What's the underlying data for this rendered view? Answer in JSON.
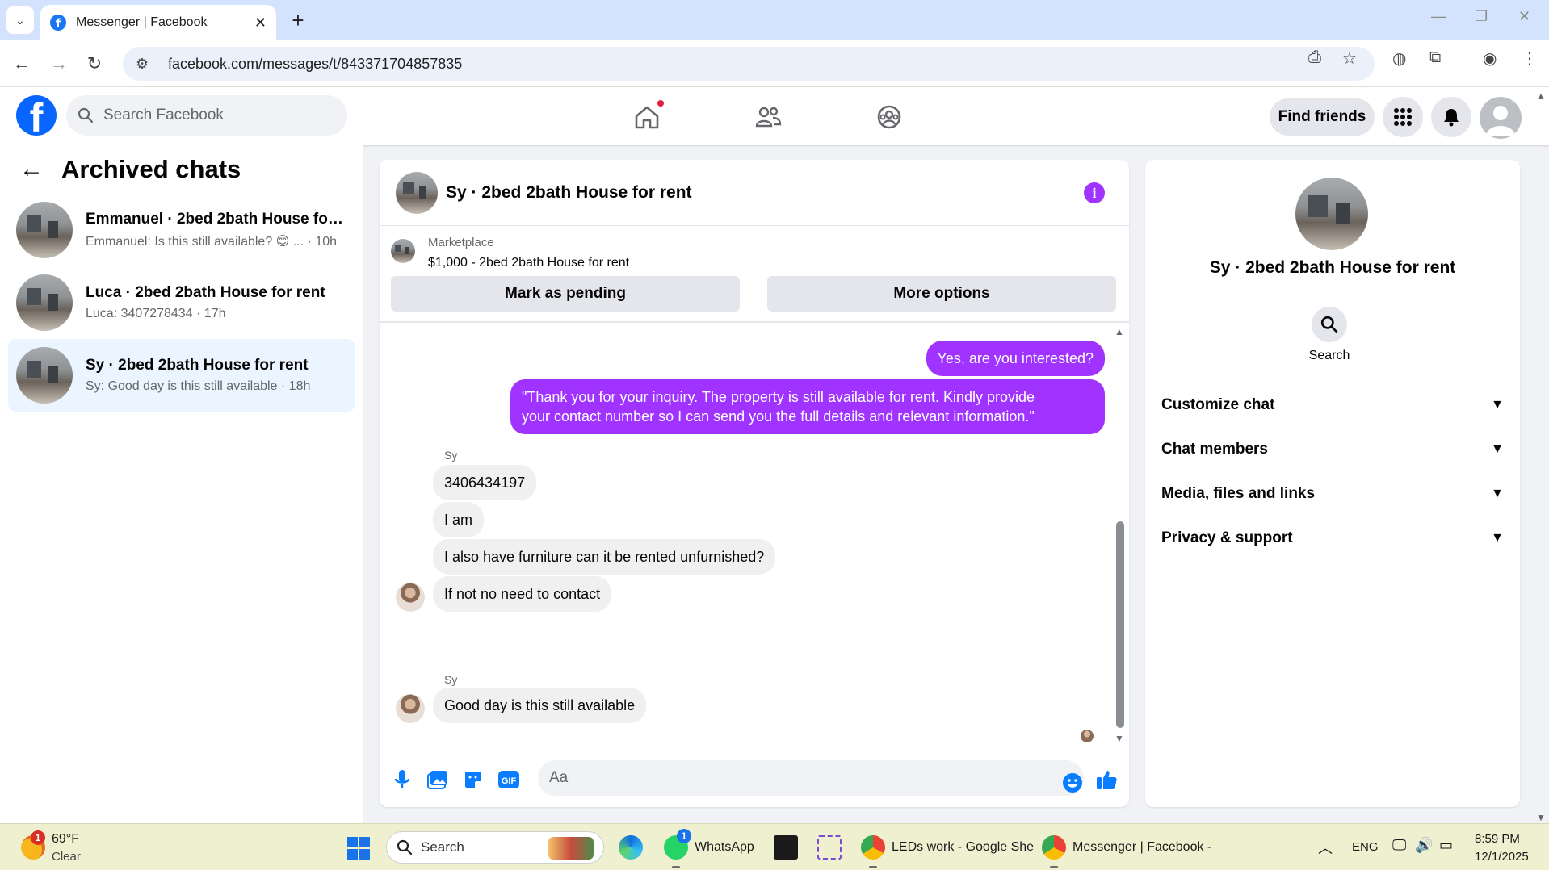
{
  "browser": {
    "tab_title": "Messenger | Facebook",
    "url": "facebook.com/messages/t/843371704857835"
  },
  "fb": {
    "search_placeholder": "Search Facebook",
    "find_friends": "Find friends"
  },
  "sidebar": {
    "title": "Archived chats",
    "chats": [
      {
        "name": "Emmanuel · 2bed 2bath House for rent",
        "preview": "Emmanuel: Is this still available? 😊 ... · 10h"
      },
      {
        "name": "Luca · 2bed 2bath House for rent",
        "preview": "Luca: 3407278434 · 17h"
      },
      {
        "name": "Sy · 2bed 2bath House for rent",
        "preview": "Sy: Good day is this still available · 18h"
      }
    ]
  },
  "conversation": {
    "title": "Sy · 2bed 2bath House for rent",
    "marketplace_label": "Marketplace",
    "listing": "$1,000 - 2bed 2bath House for rent",
    "mark_pending": "Mark as pending",
    "more_options": "More options",
    "messages": {
      "out1": "Yes, are you interested?",
      "out2_line1": "\"Thank you for your inquiry. The property is still available for rent. Kindly provide",
      "out2_line2": "your contact number so I can send you the full details and relevant information.\"",
      "sender1": "Sy",
      "in1": "3406434197",
      "in2": "I am",
      "in3": "I also have furniture can it be rented unfurnished?",
      "in4": "If not no need to contact",
      "sender2": "Sy",
      "in5": "Good day is this still available"
    },
    "composer_placeholder": "Aa"
  },
  "info_panel": {
    "name": "Sy · 2bed 2bath House for rent",
    "search_label": "Search",
    "sections": [
      "Customize chat",
      "Chat members",
      "Media, files and links",
      "Privacy & support"
    ]
  },
  "taskbar": {
    "weather_temp": "69°F",
    "weather_desc": "Clear",
    "weather_badge": "1",
    "search_label": "Search",
    "whatsapp_label": "WhatsApp",
    "whatsapp_badge": "1",
    "sheets_label": "LEDs work - Google She",
    "messenger_label": "Messenger | Facebook -",
    "lang": "ENG",
    "time": "8:59 PM",
    "date": "12/1/2025"
  },
  "colors": {
    "fb_blue": "#0866ff",
    "outgoing_bubble": "#a033ff",
    "incoming_bubble": "#f0f0f0",
    "active_chat_bg": "#ebf5ff"
  }
}
